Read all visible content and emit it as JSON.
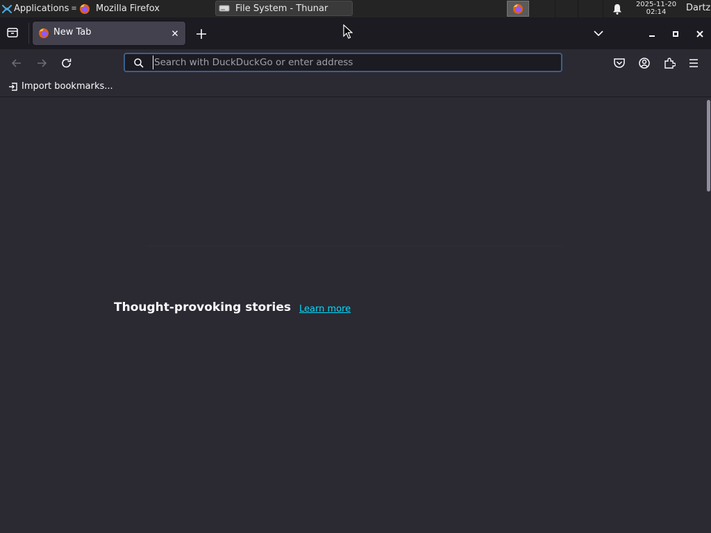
{
  "taskbar": {
    "applications_label": "Applications",
    "tasks": [
      {
        "label": "Mozilla Firefox"
      },
      {
        "label": "File System - Thunar"
      }
    ],
    "clock_date": "2025-11-20",
    "clock_time": "02:14",
    "user": "Dartz"
  },
  "browser": {
    "tab_title": "New Tab",
    "url_placeholder": "Search with DuckDuckGo or enter address",
    "bookmarks_import_label": "Import bookmarks..."
  },
  "content": {
    "stories_heading": "Thought-provoking stories",
    "learn_more_label": "Learn more"
  },
  "colors": {
    "background": "#2b2a33",
    "tabstrip": "#1c1b22",
    "active_tab": "#42414d",
    "link": "#00ddff",
    "urlbar_focus": "#3e5f8a"
  }
}
